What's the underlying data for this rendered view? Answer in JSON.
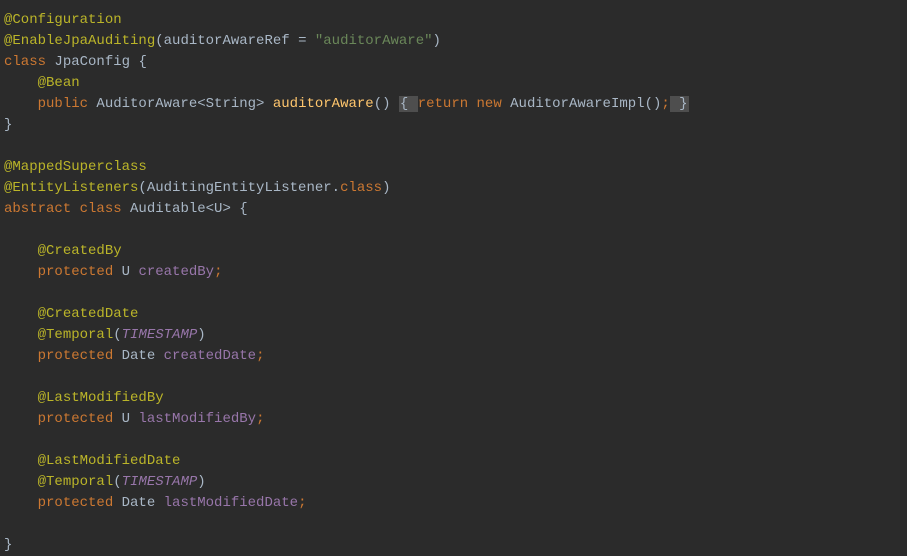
{
  "code": {
    "l1": {
      "ann": "@Configuration"
    },
    "l2": {
      "ann": "@EnableJpaAuditing",
      "p_open": "(",
      "param": "auditorAwareRef = ",
      "str": "\"auditorAware\"",
      "p_close": ")"
    },
    "l3": {
      "kw": "class ",
      "name": "JpaConfig ",
      "brace": "{"
    },
    "l4": {
      "indent": "    ",
      "ann": "@Bean"
    },
    "l5": {
      "indent": "    ",
      "mod": "public ",
      "type": "AuditorAware<String> ",
      "method": "auditorAware",
      "sig": "() ",
      "ob": "{ ",
      "ret": "return new ",
      "ctor": "AuditorAwareImpl()",
      "semi": ";",
      "cb": " }"
    },
    "l6": {
      "brace": "}"
    },
    "l7": {
      "empty": " "
    },
    "l8": {
      "ann": "@MappedSuperclass"
    },
    "l9": {
      "ann": "@EntityListeners",
      "p_open": "(",
      "arg": "AuditingEntityListener",
      "dot": ".",
      "kw": "class",
      "p_close": ")"
    },
    "l10": {
      "kw1": "abstract class ",
      "name": "Auditable<",
      "gen": "U",
      "gt": "> ",
      "brace": "{"
    },
    "l11": {
      "empty": " "
    },
    "l12": {
      "indent": "    ",
      "ann": "@CreatedBy"
    },
    "l13": {
      "indent": "    ",
      "mod": "protected ",
      "type": "U ",
      "field": "createdBy",
      "semi": ";"
    },
    "l14": {
      "empty": " "
    },
    "l15": {
      "indent": "    ",
      "ann": "@CreatedDate"
    },
    "l16": {
      "indent": "    ",
      "ann": "@Temporal",
      "p_open": "(",
      "const": "TIMESTAMP",
      "p_close": ")"
    },
    "l17": {
      "indent": "    ",
      "mod": "protected ",
      "type": "Date ",
      "field": "createdDate",
      "semi": ";"
    },
    "l18": {
      "empty": " "
    },
    "l19": {
      "indent": "    ",
      "ann": "@LastModifiedBy"
    },
    "l20": {
      "indent": "    ",
      "mod": "protected ",
      "type": "U ",
      "field": "lastModifiedBy",
      "semi": ";"
    },
    "l21": {
      "empty": " "
    },
    "l22": {
      "indent": "    ",
      "ann": "@LastModifiedDate"
    },
    "l23": {
      "indent": "    ",
      "ann": "@Temporal",
      "p_open": "(",
      "const": "TIMESTAMP",
      "p_close": ")"
    },
    "l24": {
      "indent": "    ",
      "mod": "protected ",
      "type": "Date ",
      "field": "lastModifiedDate",
      "semi": ";"
    },
    "l25": {
      "empty": " "
    },
    "l26": {
      "brace": "}"
    }
  }
}
